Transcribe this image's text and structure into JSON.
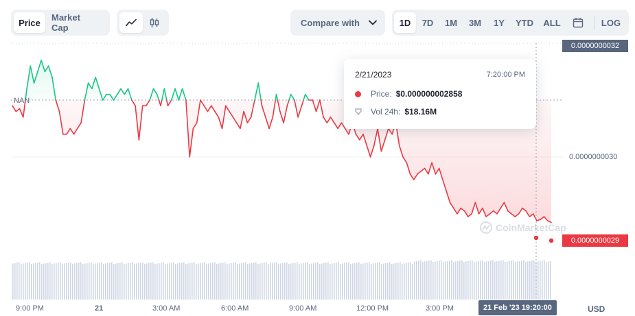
{
  "tabs": {
    "price_label": "Price",
    "market_cap_label": "Market Cap"
  },
  "chart_type_icons": [
    "line-chart-icon",
    "candlestick-icon"
  ],
  "compare": {
    "label": "Compare with"
  },
  "ranges": [
    "1D",
    "7D",
    "1M",
    "3M",
    "1Y",
    "YTD",
    "ALL"
  ],
  "active_range": "1D",
  "log_label": "LOG",
  "tooltip": {
    "date": "2/21/2023",
    "time": "7:20:00 PM",
    "price_label": "Price:",
    "price_value": "$0.000000002858",
    "vol_label": "Vol 24h:",
    "vol_value": "$18.16M"
  },
  "y_labels": {
    "top": "0.0000000032",
    "mid": "0.0000000030",
    "current": "0.0000000029"
  },
  "nan_label": "NAN",
  "x_labels": [
    "9:00 PM",
    "21",
    "3:00 AM",
    "6:00 AM",
    "9:00 AM",
    "12:00 PM",
    "3:00 PM"
  ],
  "crosshair_time": "21 Feb '23  19:20:00",
  "currency": "USD",
  "watermark": "CoinMarketCap",
  "colors": {
    "up": "#16c784",
    "down": "#ea3943",
    "text": "#58667e",
    "accent_bg": "#eff2f5"
  },
  "chart_data": {
    "type": "line",
    "baseline": 3.1e-09,
    "ylim": [
      2.85e-09,
      3.2e-09
    ],
    "series": [
      {
        "values": [
          3.09e-09,
          3.08e-09,
          3.085e-09,
          3.07e-09,
          3.12e-09,
          3.16e-09,
          3.13e-09,
          3.15e-09,
          3.17e-09,
          3.15e-09,
          3.16e-09,
          3.14e-09,
          3.1e-09,
          3.08e-09,
          3.04e-09,
          3.04e-09,
          3.05e-09,
          3.04e-09,
          3.05e-09,
          3.06e-09,
          3.1e-09,
          3.13e-09,
          3.12e-09,
          3.14e-09,
          3.12e-09,
          3.1e-09,
          3.11e-09,
          3.11e-09,
          3.1e-09,
          3.11e-09,
          3.12e-09,
          3.11e-09,
          3.12e-09,
          3.1e-09,
          3.09e-09,
          3.03e-09,
          3.09e-09,
          3.09e-09,
          3.1e-09,
          3.12e-09,
          3.11e-09,
          3.09e-09,
          3.12e-09,
          3.09e-09,
          3.1e-09,
          3.12e-09,
          3.1e-09,
          3.12e-09,
          3.1e-09,
          3e-09,
          3.05e-09,
          3.06e-09,
          3.1e-09,
          3.09e-09,
          3.08e-09,
          3.09e-09,
          3.08e-09,
          3.07e-09,
          3.05e-09,
          3.09e-09,
          3.08e-09,
          3.07e-09,
          3.06e-09,
          3.05e-09,
          3.08e-09,
          3.06e-09,
          3.07e-09,
          3.1e-09,
          3.13e-09,
          3.09e-09,
          3.07e-09,
          3.05e-09,
          3.07e-09,
          3.11e-09,
          3.08e-09,
          3.06e-09,
          3.09e-09,
          3.11e-09,
          3.1e-09,
          3.07e-09,
          3.09e-09,
          3.11e-09,
          3.1e-09,
          3.1e-09,
          3.08e-09,
          3.1e-09,
          3.07e-09,
          3.06e-09,
          3.07e-09,
          3.06e-09,
          3.05e-09,
          3.06e-09,
          3.05e-09,
          3.04e-09,
          3.06e-09,
          3.04e-09,
          3.03e-09,
          3.04e-09,
          3.02e-09,
          3e-09,
          3.02e-09,
          3.05e-09,
          3.01e-09,
          3.03e-09,
          3.05e-09,
          3.04e-09,
          3.06e-09,
          3.02e-09,
          3e-09,
          2.99e-09,
          2.97e-09,
          2.96e-09,
          2.97e-09,
          2.975e-09,
          2.98e-09,
          2.97e-09,
          2.99e-09,
          2.97e-09,
          2.98e-09,
          2.96e-09,
          2.94e-09,
          2.92e-09,
          2.91e-09,
          2.9e-09,
          2.91e-09,
          2.905e-09,
          2.895e-09,
          2.9e-09,
          2.92e-09,
          2.9e-09,
          2.91e-09,
          2.895e-09,
          2.9e-09,
          2.905e-09,
          2.9e-09,
          2.91e-09,
          2.92e-09,
          2.905e-09,
          2.9e-09,
          2.895e-09,
          2.9e-09,
          2.91e-09,
          2.905e-09,
          2.895e-09,
          2.9e-09,
          2.888e-09,
          2.89e-09,
          2.895e-09,
          2.888e-09,
          2.885e-09
        ]
      }
    ],
    "volume": "uniform bars"
  }
}
